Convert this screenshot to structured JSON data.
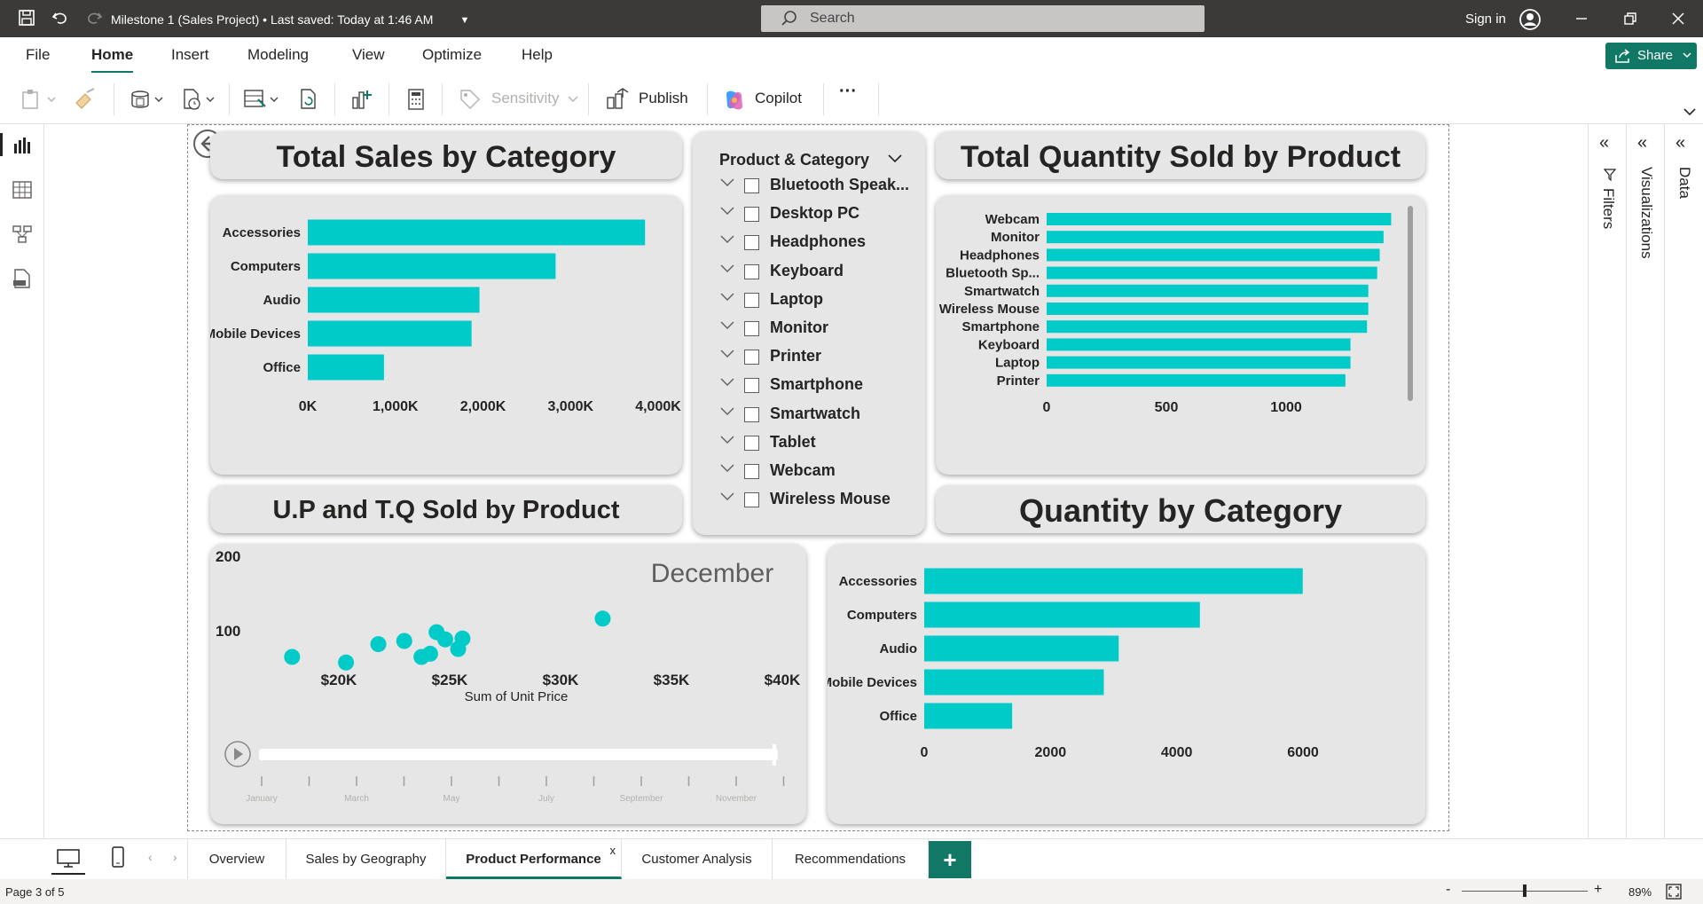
{
  "window": {
    "title": "Milestone 1 (Sales Project)  •  Last saved: Today at 1:46 AM",
    "search_placeholder": "Search",
    "sign_in": "Sign in"
  },
  "menu": {
    "items": [
      "File",
      "Home",
      "Insert",
      "Modeling",
      "View",
      "Optimize",
      "Help"
    ],
    "share": "Share"
  },
  "ribbon": {
    "sensitivity": "Sensitivity",
    "publish": "Publish",
    "copilot": "Copilot",
    "more": "···"
  },
  "panes": {
    "filters": "Filters",
    "visualizations": "Visualizations",
    "data": "Data"
  },
  "colors": {
    "bar": "#00cbc8",
    "accent": "#117865",
    "card": "#e6e6e6"
  },
  "cards": {
    "sales_title": "Total Sales by Category",
    "qty_product_title": "Total Quantity Sold by Product",
    "scatter_title": "U.P and T.Q Sold by Product",
    "qty_category_title": "Quantity by Category",
    "slicer_title": "Product & Category"
  },
  "slicer": {
    "items": [
      "Bluetooth Speak...",
      "Desktop PC",
      "Headphones",
      "Keyboard",
      "Laptop",
      "Monitor",
      "Printer",
      "Smartphone",
      "Smartwatch",
      "Tablet",
      "Webcam",
      "Wireless Mouse"
    ]
  },
  "chart_data": [
    {
      "type": "bar",
      "orientation": "horizontal",
      "title": "Total Sales by Category",
      "categories": [
        "Accessories",
        "Computers",
        "Audio",
        "Mobile Devices",
        "Office"
      ],
      "values": [
        3850,
        2830,
        1960,
        1870,
        870
      ],
      "unit": "K",
      "xlim": [
        0,
        4000
      ],
      "xticks": [
        "0K",
        "1,000K",
        "2,000K",
        "3,000K",
        "4,000K"
      ]
    },
    {
      "type": "bar",
      "orientation": "horizontal",
      "title": "Total Quantity Sold by Product",
      "categories": [
        "Webcam",
        "Monitor",
        "Headphones",
        "Bluetooth Sp...",
        "Smartwatch",
        "Wireless Mouse",
        "Smartphone",
        "Keyboard",
        "Laptop",
        "Printer"
      ],
      "values": [
        1355,
        1325,
        1310,
        1300,
        1265,
        1265,
        1260,
        1195,
        1195,
        1175
      ],
      "xlim": [
        0,
        1350
      ],
      "xticks": [
        "0",
        "500",
        "1000"
      ]
    },
    {
      "type": "scatter",
      "title": "U.P and T.Q Sold by Product",
      "xlabel": "Sum of Unit Price",
      "xticks": [
        "$20K",
        "$25K",
        "$30K",
        "$35K",
        "$40K"
      ],
      "yticks": [
        "100",
        "200"
      ],
      "xlim": [
        19000,
        41000
      ],
      "ylim": [
        60,
        210
      ],
      "play_label": "December",
      "timeline": [
        "January",
        "March",
        "May",
        "July",
        "September",
        "November"
      ],
      "points": [
        {
          "x": 19300,
          "y": 85
        },
        {
          "x": 21800,
          "y": 78
        },
        {
          "x": 23300,
          "y": 101
        },
        {
          "x": 24500,
          "y": 105
        },
        {
          "x": 25300,
          "y": 85
        },
        {
          "x": 25700,
          "y": 89
        },
        {
          "x": 26000,
          "y": 116
        },
        {
          "x": 26400,
          "y": 107
        },
        {
          "x": 27000,
          "y": 95
        },
        {
          "x": 27200,
          "y": 108
        },
        {
          "x": 33700,
          "y": 133
        }
      ]
    },
    {
      "type": "bar",
      "orientation": "horizontal",
      "title": "Quantity by Category",
      "categories": [
        "Accessories",
        "Computers",
        "Audio",
        "Mobile Devices",
        "Office"
      ],
      "values": [
        5080,
        3700,
        2610,
        2410,
        1180
      ],
      "xlim": [
        0,
        6000
      ],
      "xticks": [
        "0",
        "2000",
        "4000",
        "6000"
      ]
    }
  ],
  "tabs": {
    "items": [
      "Overview",
      "Sales by Geography",
      "Product Performance",
      "Customer Analysis",
      "Recommendations"
    ],
    "active": "Product Performance",
    "add": "+",
    "close": "x"
  },
  "status": {
    "page": "Page 3 of 5",
    "zoom": "89%",
    "minus": "-",
    "plus": "+"
  }
}
